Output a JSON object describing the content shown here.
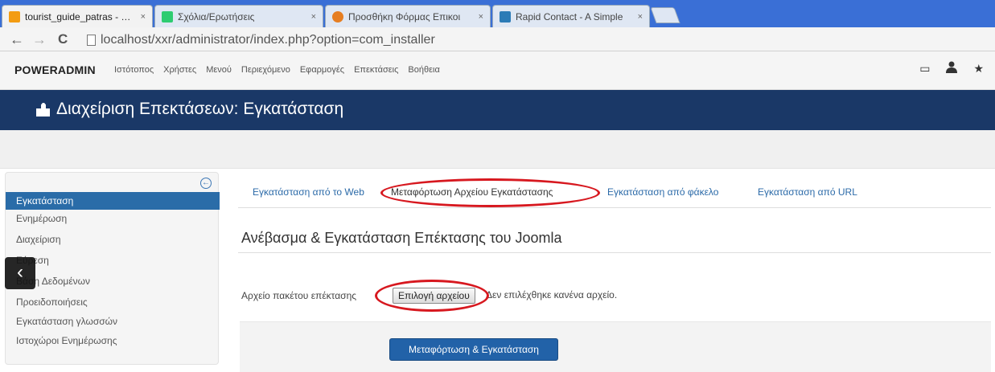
{
  "browser": {
    "tabs": [
      {
        "title": "tourist_guide_patras - Διαχ",
        "favicon_color": "#f39c12",
        "active": true
      },
      {
        "title": "Σχόλια/Ερωτήσεις",
        "favicon_color": "#2ecc71",
        "active": false
      },
      {
        "title": "Προσθήκη Φόρμας Επικοι",
        "favicon_color": "#e67e22",
        "active": false
      },
      {
        "title": "Rapid Contact - A Simple",
        "favicon_color": "#2c7bb6",
        "active": false
      }
    ],
    "close_glyph": "×",
    "back_glyph": "←",
    "forward_glyph": "→",
    "reload_glyph": "C",
    "url": "localhost/xxr/administrator/index.php?option=com_installer"
  },
  "admin": {
    "brand_bold": "POWERADMIN",
    "menu": [
      "Ιστότοπος",
      "Χρήστες",
      "Μενού",
      "Περιεχόμενο",
      "Εφαρμογές",
      "Επεκτάσεις",
      "Βοήθεια"
    ],
    "icons": [
      "monitor-icon",
      "user-icon",
      "star-icon"
    ],
    "icon_glyphs": {
      "monitor": "▭",
      "user": "👤",
      "star": "★"
    }
  },
  "page": {
    "title": "Διαχείριση Επεκτάσεων: Εγκατάσταση",
    "title_bar_color": "#1a3867"
  },
  "sidebar": {
    "collapse_glyph": "←",
    "toggle_glyph": "‹",
    "items": [
      {
        "label": "Εγκατάσταση",
        "active": true
      },
      {
        "label": "Ενημέρωση",
        "active": false
      },
      {
        "label": "Διαχείριση",
        "active": false
      },
      {
        "label": "Εύρεση",
        "active": false
      },
      {
        "label": "Βάση Δεδομένων",
        "active": false
      },
      {
        "label": "Προειδοποιήσεις",
        "active": false
      },
      {
        "label": "Εγκατάσταση γλωσσών",
        "active": false
      },
      {
        "label": "Ιστοχώροι Ενημέρωσης",
        "active": false
      }
    ]
  },
  "content": {
    "tabs": [
      "Εγκατάσταση από το Web",
      "Μεταφόρτωση Αρχείου Εγκατάστασης",
      "Εγκατάσταση από φάκελο",
      "Εγκατάσταση από URL"
    ],
    "heading": "Ανέβασμα & Εγκατάσταση Επέκτασης του Joomla",
    "field_label": "Αρχείο πακέτου επέκτασης",
    "file_button": "Επιλογή αρχείου",
    "no_file_text": "Δεν επιλέχθηκε κανένα αρχείο.",
    "submit_button": "Μεταφόρτωση & Εγκατάσταση"
  },
  "annotation_color": "#d7181f"
}
